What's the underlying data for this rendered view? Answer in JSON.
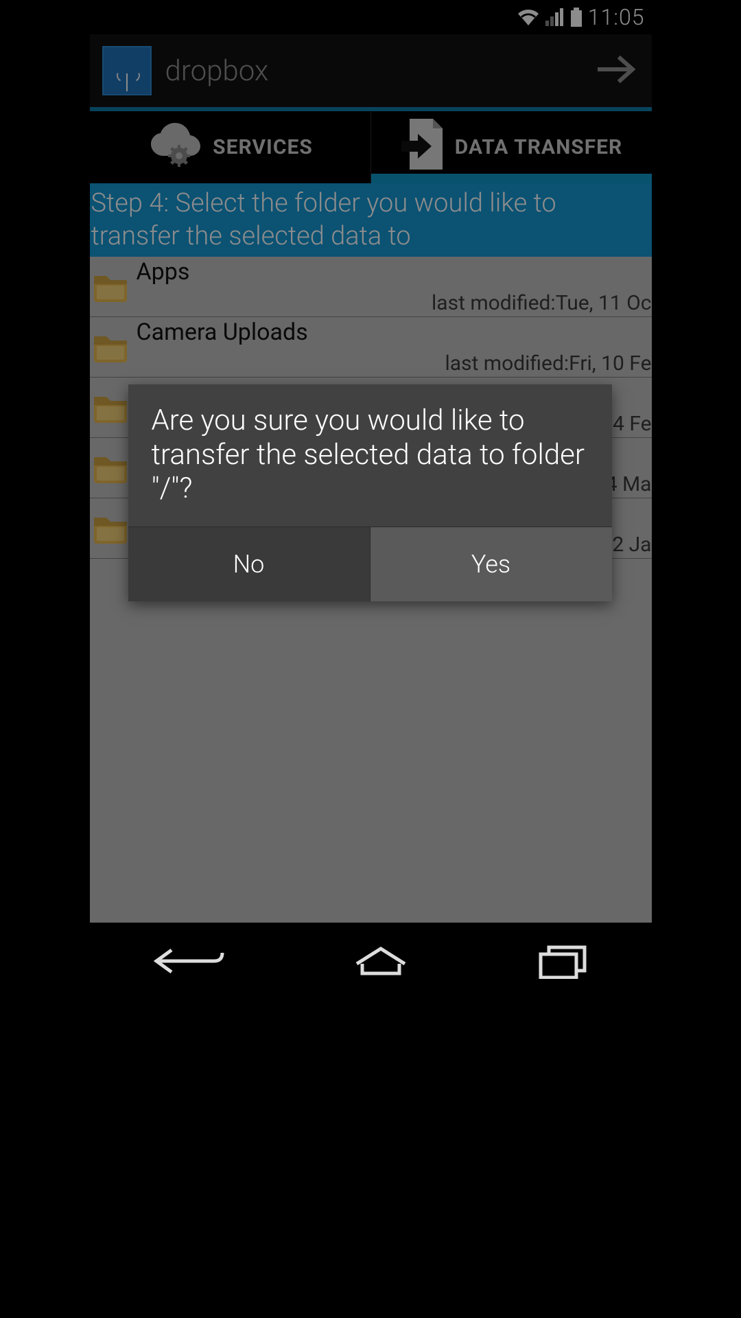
{
  "status": {
    "time": "11:05"
  },
  "title": {
    "app_name": "dropbox"
  },
  "tabs": {
    "services": "SERVICES",
    "data_transfer": "DATA TRANSFER",
    "active": "data_transfer"
  },
  "step_banner": "Step 4: Select the folder you would like to transfer the selected data to",
  "folders": [
    {
      "name": "Apps",
      "meta": "last modified:Tue, 11 Oc"
    },
    {
      "name": "Camera Uploads",
      "meta": "last modified:Fri, 10 Fe"
    },
    {
      "name": "",
      "meta": "4 Fe"
    },
    {
      "name": "",
      "meta": "4 Ma"
    },
    {
      "name": "",
      "meta": "2 Ja"
    }
  ],
  "dialog": {
    "message": "Are you sure you would like to transfer the selected data to folder \"/\"?",
    "no": "No",
    "yes": "Yes"
  },
  "colors": {
    "accent": "#0f96c8",
    "banner": "#1496d2"
  }
}
